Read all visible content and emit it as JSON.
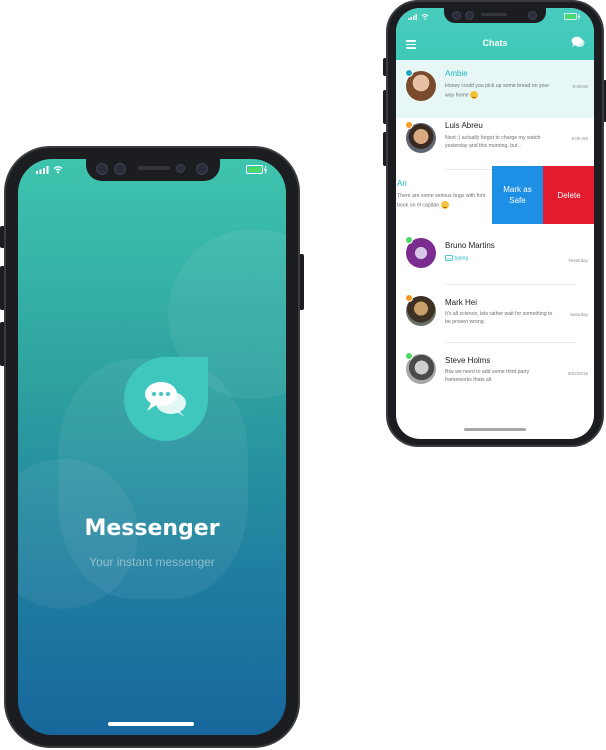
{
  "colors": {
    "splash_gradient_top": "#3fc4ae",
    "splash_gradient_bottom": "#17679c",
    "accent_teal": "#3ec9b7",
    "mark_safe_blue": "#1d8fe5",
    "delete_red": "#e31b2f",
    "online_green": "#4cd964",
    "away_orange": "#f59a23"
  },
  "splash": {
    "title": "Messenger",
    "subtitle": "Your instant messenger",
    "logo_icon": "chat-bubbles-icon"
  },
  "chats_screen": {
    "header_title": "Chats",
    "menu_icon": "hamburger-menu-icon",
    "compose_icon": "chat-bubble-icon",
    "chats": [
      {
        "name": "Ambie",
        "message": "Honey could you pick up some bread on your way home",
        "time": "8:30AM",
        "status": "online-teal",
        "highlighted": true,
        "emoji": "smile"
      },
      {
        "name": "Luis Abreu",
        "message": "Next :) actually forgot to charge my watch yesterday and this morning, but...",
        "time": "8:00 AM",
        "status": "away"
      },
      {
        "name": "Ari",
        "message": "There are some serious bugs with font book on el capitan",
        "time": "",
        "status": "none",
        "emoji": "smile",
        "swiped": true
      },
      {
        "name": "Bruno Martins",
        "message": "typing",
        "time": "Yesterday",
        "status": "online",
        "typing": true
      },
      {
        "name": "Mark Hei",
        "message": "It's all science, lets rather wait for something to be proven wrong.",
        "time": "Saturday",
        "status": "away"
      },
      {
        "name": "Steve Holms",
        "message": "Btw we need to add some third party frameworks thats all.",
        "time": "8/02/2016",
        "status": "online"
      }
    ],
    "swipe_actions": {
      "mark_safe": "Mark as\nSafe",
      "delete": "Delete"
    }
  }
}
